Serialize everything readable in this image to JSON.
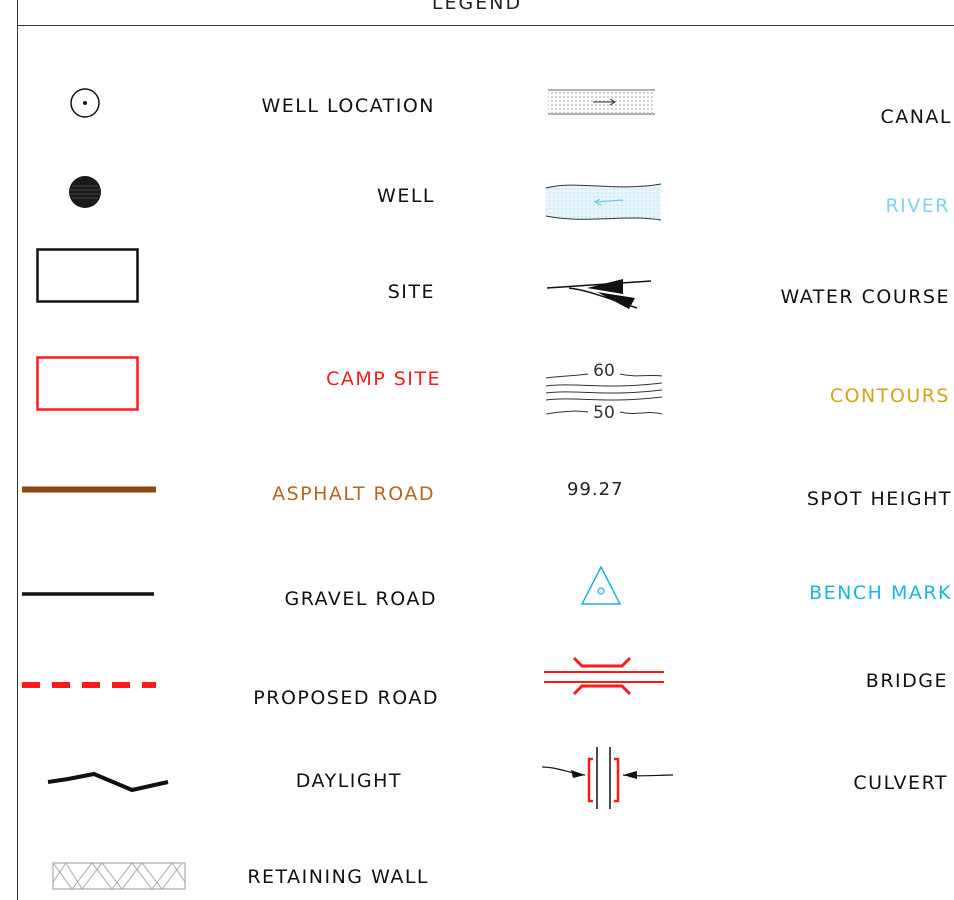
{
  "legend": {
    "title": "LEGEND",
    "left_items": [
      {
        "label": "WELL LOCATION",
        "color": "#111111",
        "symbol": "circle-dot-icon"
      },
      {
        "label": "WELL",
        "color": "#111111",
        "symbol": "filled-circle-icon"
      },
      {
        "label": "SITE",
        "color": "#111111",
        "symbol": "black-rectangle-icon"
      },
      {
        "label": "CAMP SITE",
        "color": "#ff1a1a",
        "symbol": "red-rectangle-icon"
      },
      {
        "label": "ASPHALT ROAD",
        "color": "#b8661c",
        "symbol": "brown-line-icon"
      },
      {
        "label": "GRAVEL ROAD",
        "color": "#111111",
        "symbol": "black-line-icon"
      },
      {
        "label": "PROPOSED ROAD",
        "color": "#111111",
        "symbol": "red-dashed-line-icon"
      },
      {
        "label": "DAYLIGHT",
        "color": "#111111",
        "symbol": "zigzag-line-icon"
      },
      {
        "label": "RETAINING WALL",
        "color": "#111111",
        "symbol": "hatched-wall-icon"
      }
    ],
    "right_items": [
      {
        "label": "CANAL",
        "color": "#111111",
        "symbol": "canal-icon"
      },
      {
        "label": "RIVER",
        "color": "#7fd3f0",
        "symbol": "river-icon"
      },
      {
        "label": "WATER COURSE",
        "color": "#111111",
        "symbol": "water-course-icon"
      },
      {
        "label": "CONTOURS",
        "color": "#d4a21a",
        "symbol": "contours-icon",
        "contour_values": [
          "60",
          "50"
        ]
      },
      {
        "label": "SPOT HEIGHT",
        "color": "#111111",
        "symbol": "spot-height-icon",
        "spot_value": "99.27"
      },
      {
        "label": "BENCH MARK",
        "color": "#1ab4e8",
        "symbol": "triangle-icon"
      },
      {
        "label": "BRIDGE",
        "color": "#111111",
        "symbol": "bridge-icon"
      },
      {
        "label": "CULVERT",
        "color": "#111111",
        "symbol": "culvert-icon"
      }
    ]
  }
}
